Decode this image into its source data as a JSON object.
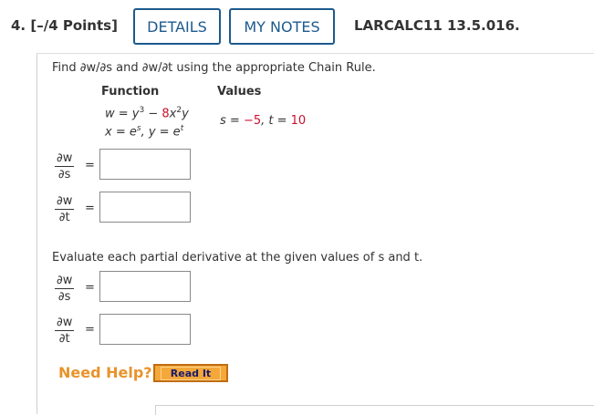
{
  "header": {
    "question_label": "4. [–/4 Points]",
    "details_label": "DETAILS",
    "notes_label": "MY NOTES",
    "course_code": "LARCALC11 13.5.016."
  },
  "problem": {
    "intro": "Find ∂w/∂s and ∂w/∂t using the appropriate Chain Rule.",
    "function_header": "Function",
    "values_header": "Values",
    "eq1_prefix": "w = y",
    "eq1_exp1": "3",
    "eq1_mid": " − ",
    "eq1_red": "8",
    "eq1_x": "x",
    "eq1_exp2": "2",
    "eq1_tail": "y",
    "eq2_a": "x = e",
    "eq2_exp_s": "s",
    "eq2_b": ",  y = e",
    "eq2_exp_t": "t",
    "values_s_label": "s = ",
    "values_s": "−5",
    "values_sep": ",  t = ",
    "values_t": "10"
  },
  "derivatives": {
    "num": "∂w",
    "den_s": "∂s",
    "den_t": "∂t",
    "equals": "="
  },
  "evaluate_text": "Evaluate each partial derivative at the given values of s and t.",
  "answers": {
    "dwds_1": "",
    "dwdt_1": "",
    "dwds_2": "",
    "dwdt_2": ""
  },
  "help": {
    "need_help": "Need Help?",
    "read_it": "Read It"
  }
}
